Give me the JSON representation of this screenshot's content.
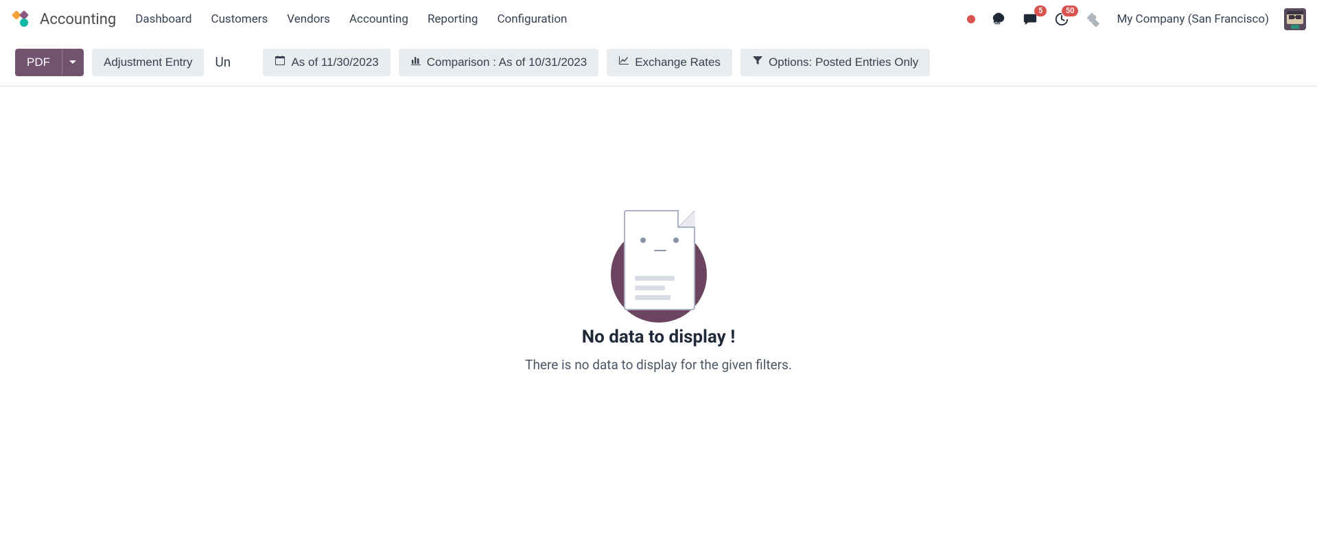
{
  "navbar": {
    "app_name": "Accounting",
    "menu": [
      "Dashboard",
      "Customers",
      "Vendors",
      "Accounting",
      "Reporting",
      "Configuration"
    ],
    "company": "My Company (San Francisco)",
    "messages_badge": "5",
    "activities_badge": "50"
  },
  "toolbar": {
    "pdf_label": "PDF",
    "adjustment_label": "Adjustment Entry",
    "truncated": "Un",
    "asof_label": "As of 11/30/2023",
    "comparison_label": "Comparison : As of 10/31/2023",
    "exchange_label": "Exchange Rates",
    "options_label": "Options: Posted Entries Only"
  },
  "empty": {
    "title": "No data to display !",
    "subtitle": "There is no data to display for the given filters."
  }
}
